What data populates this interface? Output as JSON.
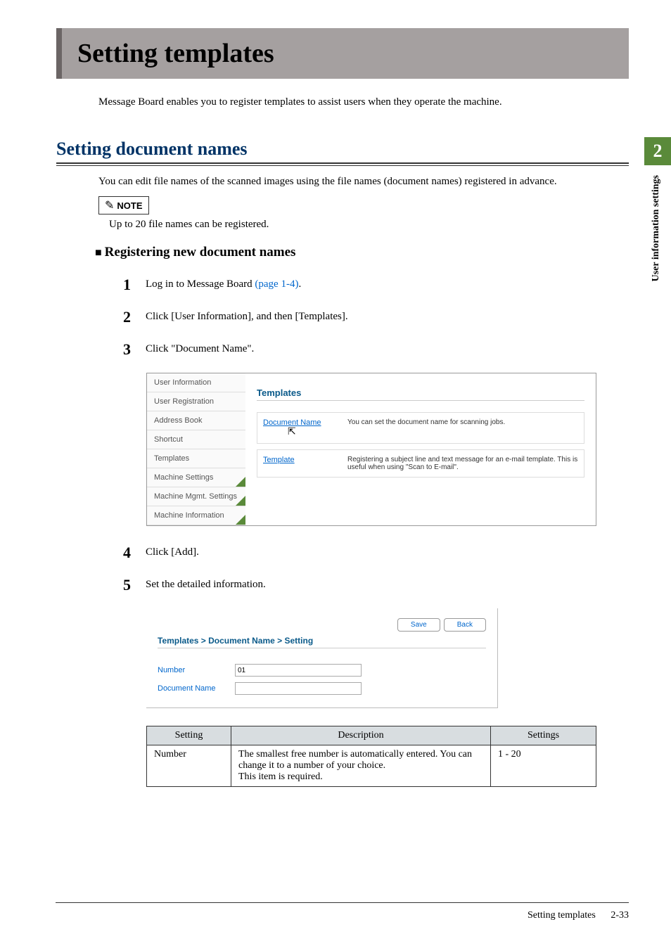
{
  "chapter": {
    "title": "Setting templates",
    "intro": "Message Board enables you to register templates to assist users when they operate the machine."
  },
  "section": {
    "title": "Setting document names",
    "text": "You can edit file names of the scanned images using the file names (document names) registered in advance."
  },
  "note": {
    "icon": "✎",
    "label": "NOTE",
    "text": "Up to 20 file names can be registered."
  },
  "subsection": {
    "bullet": "■",
    "title": "Registering new document names"
  },
  "steps": {
    "s1": {
      "num": "1",
      "text_pre": "Log in to Message Board ",
      "link": "(page 1-4)",
      "text_post": "."
    },
    "s2": {
      "num": "2",
      "text": "Click [User Information], and then [Templates]."
    },
    "s3": {
      "num": "3",
      "text": "Click \"Document Name\"."
    },
    "s4": {
      "num": "4",
      "text": "Click [Add]."
    },
    "s5": {
      "num": "5",
      "text": "Set the detailed information."
    }
  },
  "screenshot1": {
    "sidebar": {
      "t1": "User Information",
      "t2": "User Registration",
      "t3": "Address Book",
      "t4": "Shortcut",
      "t5": "Templates",
      "t6": "Machine Settings",
      "t7": "Machine Mgmt. Settings",
      "t8": "Machine Information"
    },
    "main": {
      "heading": "Templates",
      "row1": {
        "link": "Document Name",
        "desc": "You can set the document name for scanning jobs."
      },
      "row2": {
        "link": "Template",
        "desc": "Registering a subject line and text message for an e-mail template. This is useful when using \"Scan to E-mail\"."
      }
    }
  },
  "screenshot2": {
    "btn_save": "Save",
    "btn_back": "Back",
    "heading": "Templates > Document Name > Setting",
    "field1": {
      "label": "Number",
      "value": "01"
    },
    "field2": {
      "label": "Document Name",
      "value": ""
    }
  },
  "table": {
    "h1": "Setting",
    "h2": "Description",
    "h3": "Settings",
    "r1c1": "Number",
    "r1c2": "The smallest free number is automatically entered.  You can change it to a number of your choice.\nThis item is required.",
    "r1c3": "1 - 20"
  },
  "sidetab": {
    "num": "2",
    "text": "User information settings"
  },
  "footer": {
    "title": "Setting templates",
    "page": "2-33"
  }
}
